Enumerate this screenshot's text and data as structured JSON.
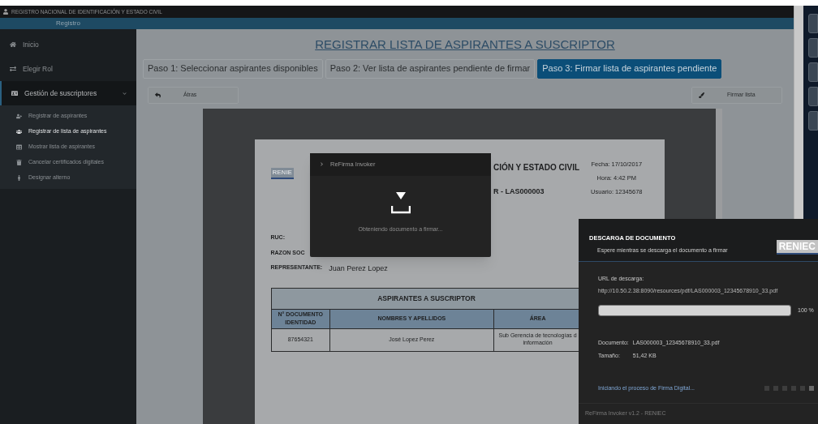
{
  "app_title": "REGISTRO NACIONAL DE IDENTIFICACIÓN Y ESTADO CIVIL",
  "header": {
    "label": "Registro"
  },
  "sidebar": {
    "items": [
      {
        "label": "Inicio",
        "selected": false
      },
      {
        "label": "Elegir Rol",
        "selected": false
      },
      {
        "label": "Gestión de suscriptores",
        "selected": true,
        "expanded": true,
        "children": [
          {
            "label": "Registrar de aspirantes",
            "selected": false
          },
          {
            "label": "Registrar de lista de aspirantes",
            "selected": true
          },
          {
            "label": "Mostrar lista de aspirantes",
            "selected": false
          },
          {
            "label": "Cancelar certificados digitales",
            "selected": false
          },
          {
            "label": "Designar alterno",
            "selected": false
          }
        ]
      }
    ]
  },
  "page_title": "REGISTRAR LISTA DE ASPIRANTES A SUSCRIPTOR",
  "steps": [
    {
      "label": "Paso 1: Seleccionar aspirantes disponibles",
      "selected": false
    },
    {
      "label": "Paso 2: Ver lista de aspirantes pendiente de firmar",
      "selected": false
    },
    {
      "label": "Paso 3: Firmar lista de aspirantes pendiente",
      "selected": true
    }
  ],
  "back_button": "Átras",
  "sign_button": "Firmar lista",
  "document": {
    "logo_text": "RENIE",
    "heading": "CIÓN Y ESTADO CIVIL",
    "subheading": "R - LAS000003",
    "meta": [
      "Fecha: 17/10/2017",
      "Hora: 4:42 PM",
      "Usuario: 12345678"
    ],
    "fields": [
      {
        "label": "RUC:"
      },
      {
        "label": "RAZON SOC"
      },
      {
        "label": "REPRESENTANTE:",
        "value": "Juan Perez Lopez"
      }
    ],
    "table": {
      "title": "ASPIRANTES A SUSCRIPTOR",
      "columns": [
        "N° DOCUMENTO IDENTIDAD",
        "NOMBRES Y APELLIDOS",
        "ÁREA"
      ],
      "rows": [
        [
          "87654321",
          "José Lopez Perez",
          "Sub Gerencia de tecnologías d información"
        ]
      ]
    }
  },
  "invoker": {
    "title": "ReFirma Invoker",
    "message": "Obteniendo documento a firmar..."
  },
  "download": {
    "title": "DESCARGA DE DOCUMENTO",
    "subtitle": "Espere mientras se descarga el documento a firmar",
    "logo_text": "RENIEC",
    "url_label": "URL de descarga:",
    "url": "http://10.50.2.38:8090/resources/pdf/LAS000003_12345678910_33.pdf",
    "level": 1,
    "percent": "100 %",
    "document_label": "Documento:",
    "document_value": "LAS000003_12345678910_33.pdf",
    "size_label": "Tamaño:",
    "size_value": "51,42 KB",
    "status": "Iniciando el proceso de Firma Digital...",
    "footer": "ReFirma Invoker v1.2 - RENIEC"
  }
}
